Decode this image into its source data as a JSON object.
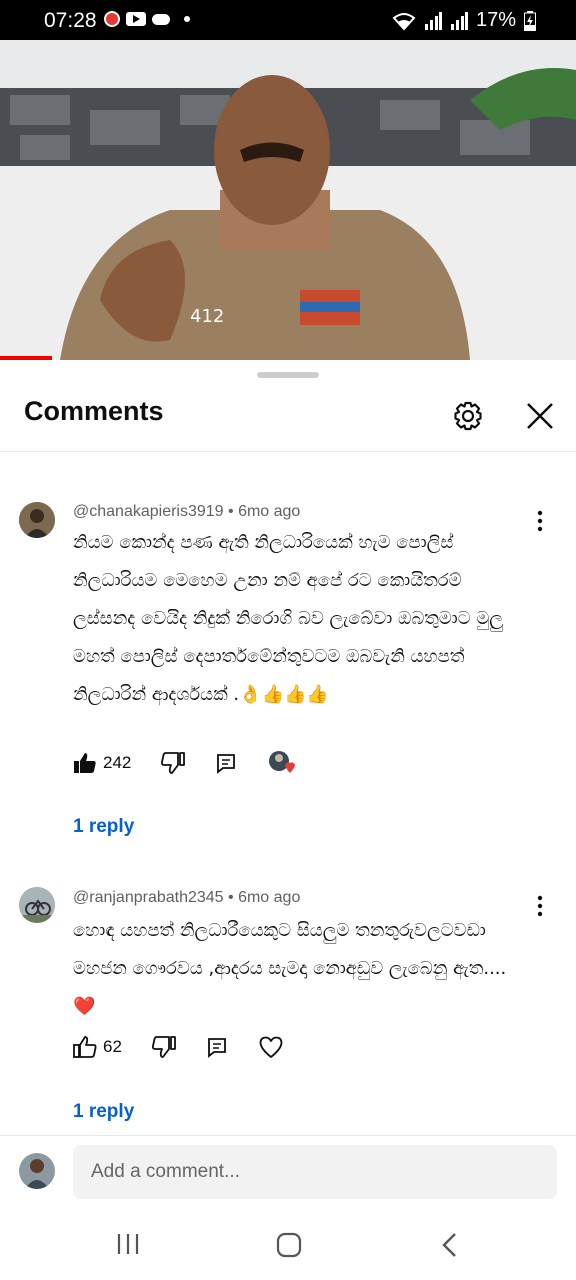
{
  "status_bar": {
    "time": "07:28",
    "battery": "17%"
  },
  "panel": {
    "title": "Comments"
  },
  "comments": [
    {
      "author": "@chanakapieris3919",
      "age": "6mo ago",
      "text": "නියම කොන්ද පණ ඇති නිලධාරියෙක් හැම පොලිස් නිලධාරියම මෙහෙම උනා නම් අපේ රට කොයිතරම් ලස්සනද වෙයිද නිදුක් නිරොගි බව ලැබේවා ඔබතුමාට මුලු මහත් පොලිස් දෙපාර්තමේන්තුවටම ඔබවැනි යහපත් නිලධාරින් ආදර්ශයක් .👌👍👍👍",
      "likes": "242",
      "replies": "1 reply"
    },
    {
      "author": "@ranjanprabath2345",
      "age": "6mo ago",
      "text": "හොඳ යහපත් නිලධාරීයෙකුට සියලුම තනතුරුවලටවඩා මහජන ගෞරවය ,ආදරය සැමදා නොඅඩුව ලැබෙනු ඇත....❤️",
      "likes": "62",
      "replies": "1 reply"
    }
  ],
  "composer": {
    "placeholder": "Add a comment..."
  },
  "icons": {
    "gear": "gear-icon",
    "close": "close-icon",
    "more": "more-vert-icon",
    "like": "thumb-up-icon",
    "dislike": "thumb-down-icon",
    "reply": "comment-icon",
    "heart": "heart-icon"
  },
  "colors": {
    "link": "#065fd4",
    "progress": "#ee0000",
    "creator_heart": "#e53935"
  }
}
